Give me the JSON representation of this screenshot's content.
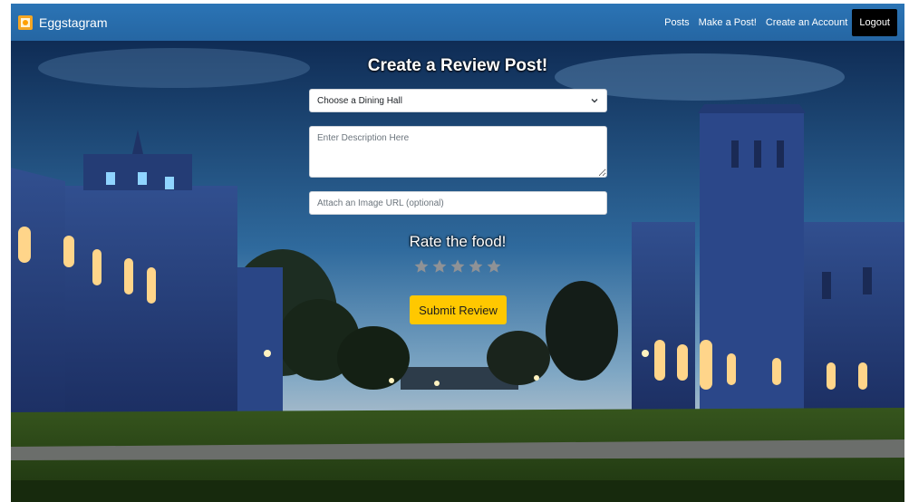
{
  "navbar": {
    "brand": "Eggstagram",
    "links": [
      "Posts",
      "Make a Post!",
      "Create an Account"
    ],
    "logout_label": "Logout"
  },
  "form": {
    "title": "Create a Review Post!",
    "dining_hall_selected": "Choose a Dining Hall",
    "description_placeholder": "Enter Description Here",
    "image_url_placeholder": "Attach an Image URL (optional)",
    "rate_label": "Rate the food!",
    "rating": 0,
    "rating_max": 5,
    "submit_label": "Submit Review"
  },
  "colors": {
    "navbar": "#2b74b5",
    "submit": "#ffc800",
    "star_empty": "#8f9296"
  }
}
